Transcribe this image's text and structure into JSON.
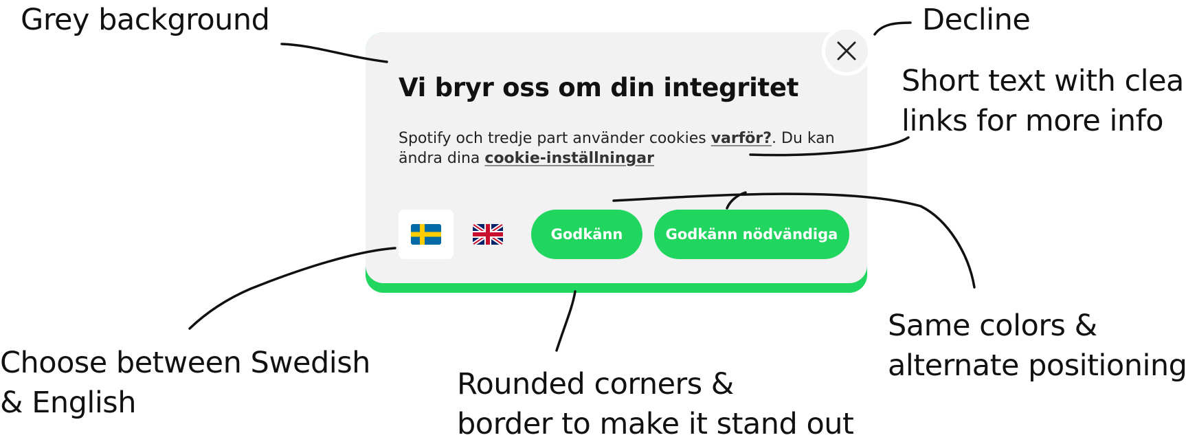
{
  "annotations": {
    "grey_background": "Grey background",
    "decline": "Decline",
    "short_text_line1": "Short text with clear",
    "short_text_line2": "links for more info",
    "same_colors_line1": "Same colors &",
    "same_colors_line2": "alternate positioning",
    "language_line1": "Choose between Swedish",
    "language_line2": "& English",
    "rounded_line1": "Rounded corners &",
    "rounded_line2": "border to make it stand out"
  },
  "banner": {
    "title": "Vi bryr oss om din integritet",
    "text_part1": "Spotify och tredje part använder cookies ",
    "why_link": "varför?",
    "text_part2": ". Du kan ändra dina ",
    "settings_link": "cookie-inställningar",
    "accept_label": "Godkänn",
    "accept_necessary_label": "Godkänn nödvändiga",
    "languages": [
      {
        "name": "Swedish",
        "icon": "swedish-flag-icon",
        "selected": true
      },
      {
        "name": "English",
        "icon": "uk-flag-icon",
        "selected": false
      }
    ],
    "colors": {
      "accent": "#20d65f",
      "background": "#f2f2f2"
    }
  }
}
